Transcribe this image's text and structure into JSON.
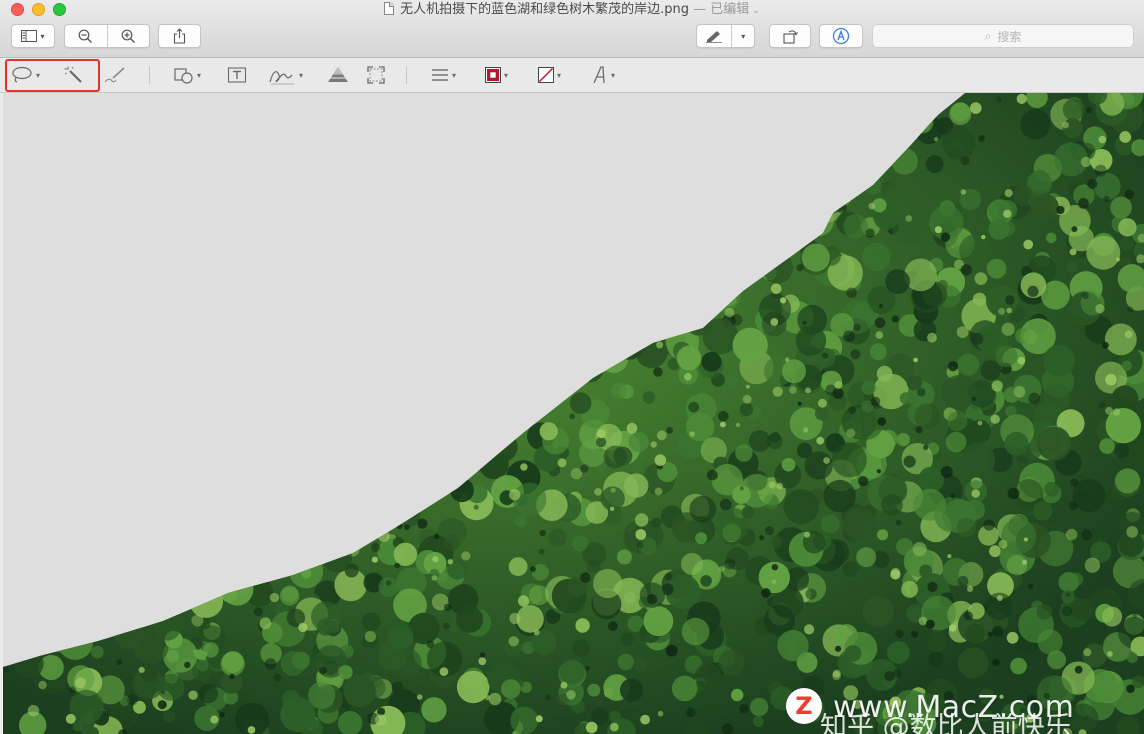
{
  "window": {
    "title": "无人机拍摄下的蓝色湖和绿色树木繁茂的岸边.png",
    "status": "— 已编辑",
    "status_chevron": "⌄"
  },
  "toolbar": {
    "sidebar_icon": "sidebar-icon",
    "zoom_out_icon": "zoom-out-icon",
    "zoom_in_icon": "zoom-in-icon",
    "share_icon": "share-icon",
    "markup_pen_icon": "pen-icon",
    "rotate_icon": "rotate-icon",
    "annotate_icon": "markup-icon",
    "search_placeholder": "搜索"
  },
  "markup_tools": [
    {
      "name": "lasso-selection",
      "icon": "lasso-icon",
      "has_menu": true
    },
    {
      "name": "instant-alpha",
      "icon": "magic-wand-icon",
      "has_menu": false
    },
    {
      "name": "sketch",
      "icon": "sketch-icon",
      "has_menu": false
    },
    {
      "name": "shapes",
      "icon": "shapes-icon",
      "has_menu": true
    },
    {
      "name": "text",
      "icon": "text-box-icon",
      "has_menu": false
    },
    {
      "name": "sign",
      "icon": "signature-icon",
      "has_menu": true
    },
    {
      "name": "adjust-color",
      "icon": "adjust-color-icon",
      "has_menu": false
    },
    {
      "name": "adjust-size",
      "icon": "resize-icon",
      "has_menu": false
    },
    {
      "name": "shape-style",
      "icon": "lines-icon",
      "has_menu": true
    },
    {
      "name": "border-color",
      "icon": "border-color-icon",
      "has_menu": true
    },
    {
      "name": "fill-color",
      "icon": "fill-color-icon",
      "has_menu": true
    },
    {
      "name": "text-style",
      "icon": "text-style-icon",
      "has_menu": true
    }
  ],
  "colors": {
    "highlight": "#e0342b",
    "forest_dark": "#1f4a22",
    "forest_mid": "#2f6b2c",
    "forest_light": "#5c9a3a",
    "removed_background": "#dedede"
  },
  "watermark": {
    "logo_letter": "Z",
    "url": "www.MacZ.com",
    "zhihu": "知乎 @数比人前快乐"
  }
}
